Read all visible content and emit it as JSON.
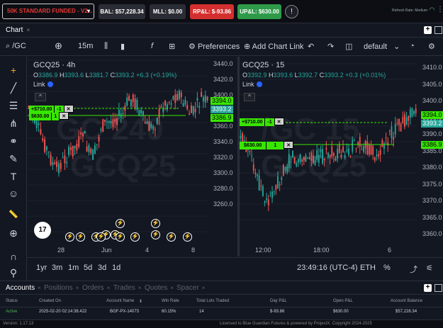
{
  "topbar": {
    "account": "50K STANDARD FUNDED - V2...",
    "caret": "▾",
    "bal": "BAL: $57,228.34",
    "mll": "MLL: $0.00",
    "rpl": "RP&L: $-93.86",
    "upl": "UP&L: $630.00",
    "info": "!",
    "refresh": "Refresh Rate: Medium",
    "wifi": "◠",
    "kebab": "⋮"
  },
  "chart_tab": {
    "label": "Chart",
    "close": "×"
  },
  "window_buttons": {
    "add": "+",
    "max": "☐"
  },
  "toolbar": {
    "symbol": "/GC",
    "interval": "15m",
    "preferences": "Preferences",
    "add_chart_link": "Add Chart Link",
    "layout": "default",
    "search_icon": "⌕",
    "plus_icon": "⊕",
    "bars_icon": "⫼",
    "candle_icon": "▮",
    "fx_icon": "f",
    "grid_icon": "⊞",
    "gear_icon": "⚙",
    "undo_icon": "↶",
    "redo_icon": "↷",
    "panel_icon": "◫",
    "chevron": "⌄",
    "camera_icon": "◔"
  },
  "left_tools": [
    "+",
    "╱",
    "☰",
    "⋔",
    "⚭",
    "✎",
    "T",
    "☺",
    "📏",
    "⊕",
    "∩",
    "⚲"
  ],
  "pane_left": {
    "title": "GCQ25 · 4h",
    "ohlc": {
      "o": "3386.9",
      "h": "3393.6",
      "l": "3381.7",
      "c": "3393.2",
      "chg": "+6.3 (+0.19%)"
    },
    "link": "Link",
    "collapse": "^",
    "watermark1": "GC 240",
    "watermark2": "GCQ25",
    "y_ticks": [
      "3440.0",
      "3420.0",
      "3400.0",
      "3380.0",
      "3360.0",
      "3340.0",
      "3320.0",
      "3300.0",
      "3280.0",
      "3260.0"
    ],
    "x_ticks": [
      "28",
      "Jun",
      "4",
      "8"
    ],
    "price_tags": [
      "3394.0",
      "3393.2",
      "3386.9"
    ],
    "order_top": {
      "pnl": "+$710.00",
      "qty": "-1",
      "x": "✕"
    },
    "order_bot": {
      "pnl": "$630.00",
      "qty": "1",
      "x": "✕"
    },
    "tv": "17"
  },
  "pane_right": {
    "title": "GCQ25 · 15",
    "ohlc": {
      "o": "3392.9",
      "h": "3393.6",
      "l": "3392.7",
      "c": "3393.2",
      "chg": "+0.3 (+0.01%)"
    },
    "link": "Link",
    "collapse": "^",
    "watermark1": "/GC 15",
    "watermark2": "GCQ25",
    "y_ticks": [
      "3410.0",
      "3405.0",
      "3400.0",
      "3395.0",
      "3390.0",
      "3385.0",
      "3380.0",
      "3375.0",
      "3370.0",
      "3365.0",
      "3360.0"
    ],
    "x_ticks": [
      "12:00",
      "18:00",
      "6"
    ],
    "price_tags": [
      "3394.0",
      "3393.2",
      "3386.9"
    ],
    "order_top": {
      "pnl": "+$710.00",
      "qty": "-1",
      "x": "✕"
    },
    "order_bot": {
      "pnl": "$630.00",
      "qty": "1",
      "x": "✕"
    }
  },
  "bottombar": {
    "ranges": [
      "1yr",
      "3m",
      "1m",
      "5d",
      "3d",
      "1d"
    ],
    "time": "23:49:16 (UTC-4)",
    "currency": "ETH",
    "pct": "%",
    "log_icon": "⤴",
    "auto_icon": "⚟"
  },
  "acct_tabs": [
    "Accounts",
    "Positions",
    "Orders",
    "Trades",
    "Quotes",
    "Spacer"
  ],
  "acct_table": {
    "headers": [
      "Status",
      "Created On",
      "Account Name",
      "Win Rate",
      "Total Lots Traded",
      "Day P&L",
      "Open P&L",
      "Account Balance"
    ],
    "row": [
      "Active",
      "2025-02-20 02:14:38.422",
      "BGF-PX-14073",
      "60.15%",
      "14",
      "$-93.86",
      "$630.00",
      "$57,228.34"
    ]
  },
  "footer": {
    "version": "Version: 1.17.13",
    "license": "Licensed to Blue Guardian Futures & powered by ProjectX. Copyright 2024-2025"
  },
  "colors": {
    "up": "#26a69a",
    "down": "#ef5350",
    "order": "#39e600"
  }
}
